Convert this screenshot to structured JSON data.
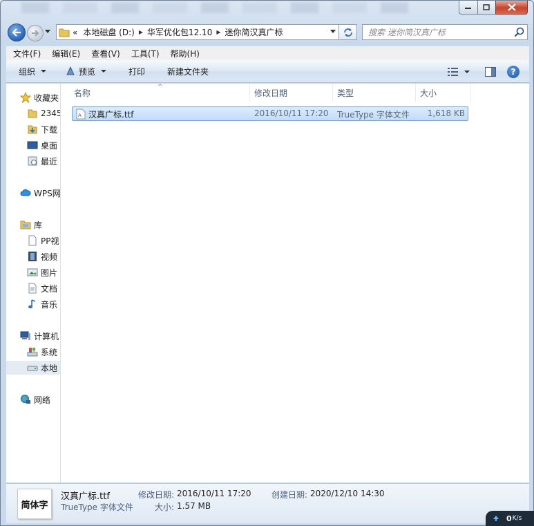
{
  "window": {
    "title_blurred": true
  },
  "nav": {
    "breadcrumb_prefix": "«",
    "breadcrumbs": [
      "本地磁盘 (D:)",
      "华军优化包12.10",
      "迷你简汉真广标"
    ],
    "search_placeholder": "搜索 迷你简汉真广标"
  },
  "menu": [
    "文件(F)",
    "编辑(E)",
    "查看(V)",
    "工具(T)",
    "帮助(H)"
  ],
  "toolbar": {
    "organize": "组织",
    "preview": "预览",
    "print": "打印",
    "new_folder": "新建文件夹",
    "help": "?"
  },
  "sidebar": {
    "favorites": "收藏夹",
    "fav_items": [
      "2345",
      "下载",
      "桌面",
      "最近"
    ],
    "wps": "WPS网",
    "library": "库",
    "lib_items": [
      "PP视",
      "视频",
      "图片",
      "文档",
      "音乐"
    ],
    "computer": "计算机",
    "comp_items": [
      "系统",
      "本地"
    ],
    "network": "网络"
  },
  "columns": {
    "name": "名称",
    "modified": "修改日期",
    "type": "类型",
    "size": "大小"
  },
  "files": [
    {
      "name": "汉真广标.ttf",
      "modified": "2016/10/11 17:20",
      "type": "TrueType 字体文件",
      "size": "1,618 KB"
    }
  ],
  "details": {
    "thumb_text": "简体字",
    "filename": "汉真广标.ttf",
    "filetype": "TrueType 字体文件",
    "modified_label": "修改日期:",
    "modified": "2016/10/11 17:20",
    "created_label": "创建日期:",
    "created": "2020/12/10 14:30",
    "size_label": "大小:",
    "size": "1.57 MB"
  },
  "net_widget": {
    "value": "0",
    "unit": "K/s"
  },
  "colors": {
    "selection": "#cce4fc",
    "selection_border": "#7da2ce",
    "chrome": "#c9d9ec"
  }
}
